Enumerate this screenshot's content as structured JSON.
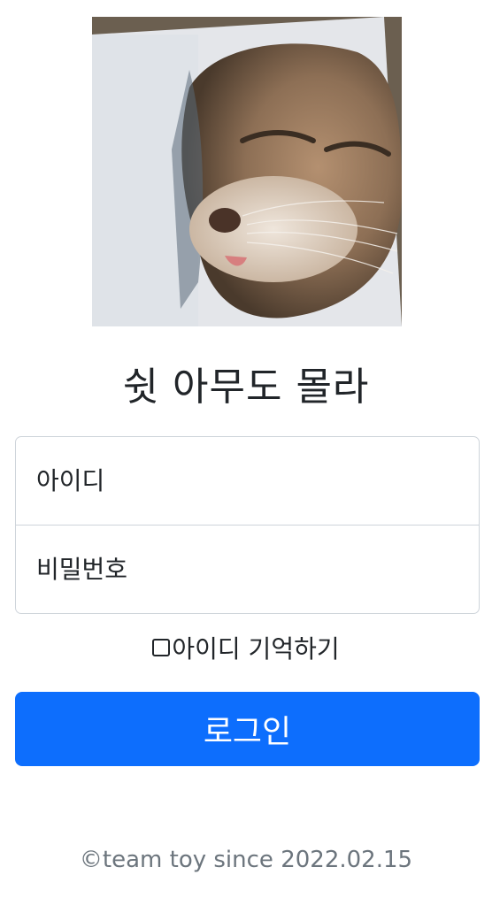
{
  "hero": {
    "image_name": "cat-photo"
  },
  "title": "쉿 아무도 몰라",
  "form": {
    "id_placeholder": "아이디",
    "password_placeholder": "비밀번호",
    "remember_label": "아이디 기억하기",
    "remember_checked": false,
    "submit_label": "로그인"
  },
  "footer": {
    "text": "©team toy since 2022.02.15"
  },
  "colors": {
    "primary": "#0d6efd",
    "muted": "#6c757d",
    "border": "#ced4da",
    "text": "#212529"
  }
}
